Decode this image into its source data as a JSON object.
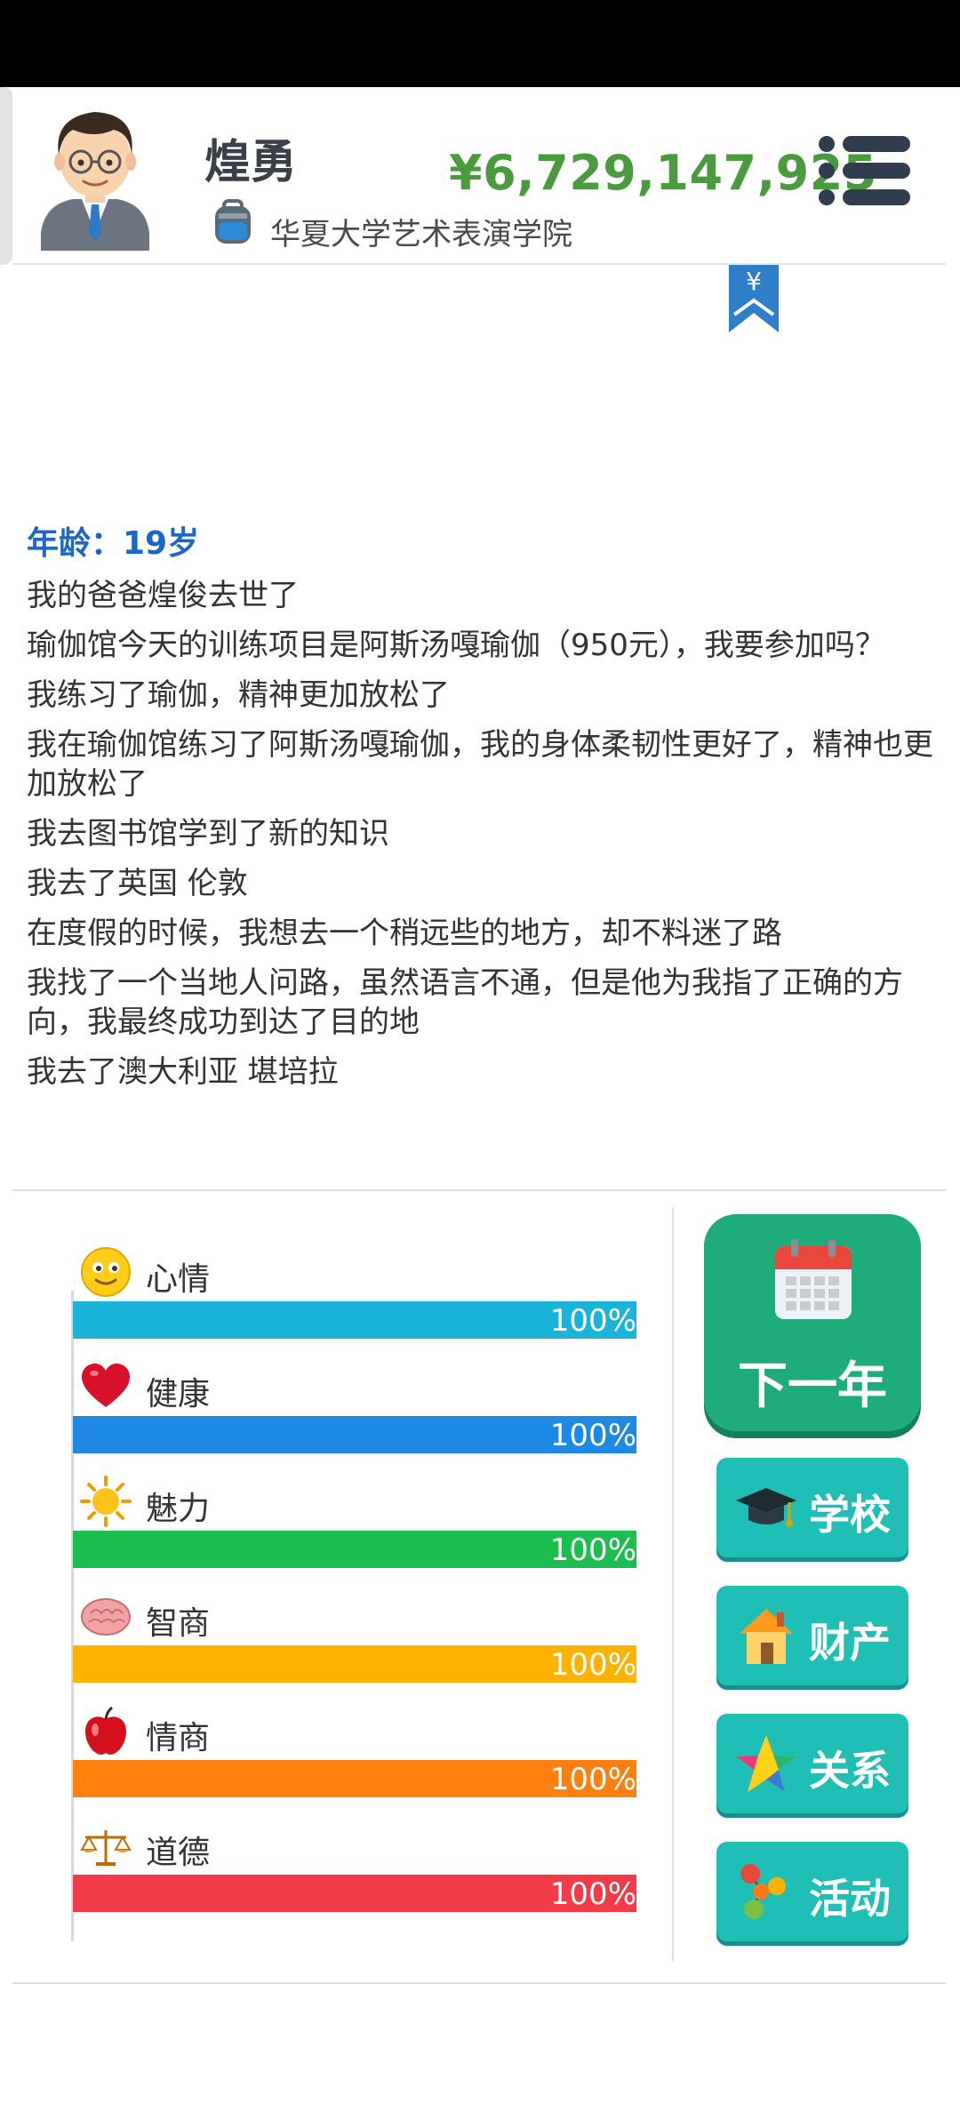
{
  "header": {
    "name": "煌勇",
    "school": "华夏大学艺术表演学院",
    "money": "¥6,729,147,925",
    "bookmark_symbol": "¥"
  },
  "log": {
    "age": "年龄：19岁",
    "lines": [
      "我的爸爸煌俊去世了",
      "瑜伽馆今天的训练项目是阿斯汤嘎瑜伽（950元），我要参加吗？",
      "我练习了瑜伽，精神更加放松了",
      "我在瑜伽馆练习了阿斯汤嘎瑜伽，我的身体柔韧性更好了，精神也更加放松了",
      "我去图书馆学到了新的知识",
      "我去了英国 伦敦",
      "在度假的时候，我想去一个稍远些的地方，却不料迷了路",
      "我找了一个当地人问路，虽然语言不通，但是他为我指了正确的方向，我最终成功到达了目的地",
      "我去了澳大利亚 堪培拉"
    ]
  },
  "stats": [
    {
      "label": "心情",
      "value": 100,
      "pct": "100%",
      "color": "#1ab3d9",
      "icon": "smiley-icon"
    },
    {
      "label": "健康",
      "value": 100,
      "pct": "100%",
      "color": "#1e88e5",
      "icon": "heart-icon"
    },
    {
      "label": "魅力",
      "value": 100,
      "pct": "100%",
      "color": "#1cbf4f",
      "icon": "sun-icon"
    },
    {
      "label": "智商",
      "value": 100,
      "pct": "100%",
      "color": "#ffb300",
      "icon": "brain-icon"
    },
    {
      "label": "情商",
      "value": 100,
      "pct": "100%",
      "color": "#ff7f0f",
      "icon": "apple-icon"
    },
    {
      "label": "道德",
      "value": 100,
      "pct": "100%",
      "color": "#f23a49",
      "icon": "scales-icon"
    }
  ],
  "buttons": {
    "next_year": "下一年",
    "school": "学校",
    "property": "财产",
    "relations": "关系",
    "activities": "活动"
  }
}
